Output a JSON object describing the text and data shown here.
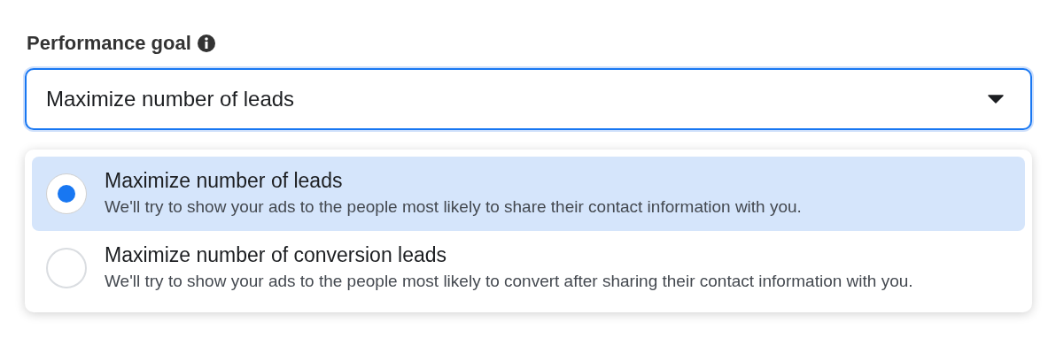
{
  "field": {
    "label": "Performance goal",
    "value": "Maximize number of leads",
    "expanded": true
  },
  "options": [
    {
      "title": "Maximize number of leads",
      "description": "We'll try to show your ads to the people most likely to share their contact information with you.",
      "selected": true
    },
    {
      "title": "Maximize number of conversion leads",
      "description": "We'll try to show your ads to the people most likely to convert after sharing their contact information with you.",
      "selected": false
    }
  ]
}
